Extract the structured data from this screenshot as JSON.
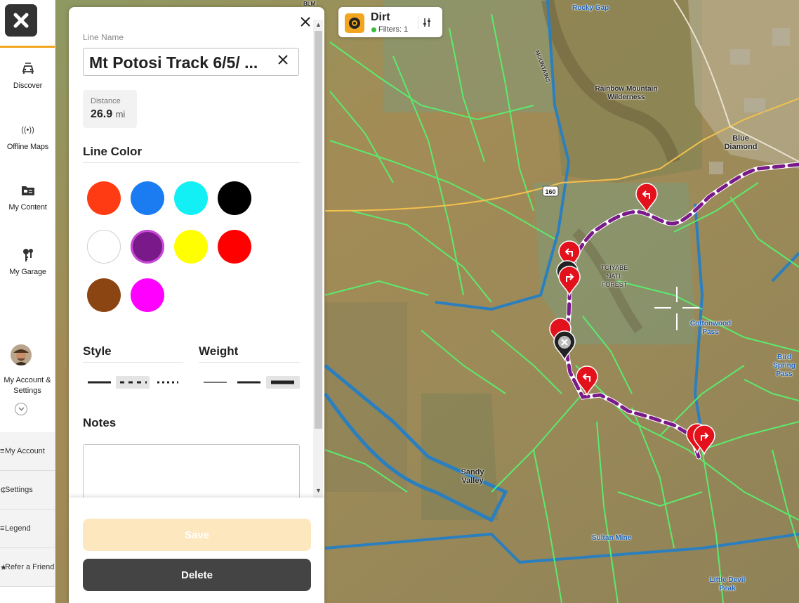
{
  "nav": {
    "items": [
      {
        "label": "Discover",
        "icon": "discover-icon"
      },
      {
        "label": "Offline Maps",
        "icon": "offline-maps-icon",
        "glyph": "((•))"
      },
      {
        "label": "My Content",
        "icon": "my-content-icon"
      },
      {
        "label": "My Garage",
        "icon": "keys-icon"
      }
    ],
    "account": {
      "label": "My Account & Settings"
    },
    "submenu": [
      {
        "label": "My Account",
        "glyph": "≡"
      },
      {
        "label": "Settings",
        "glyph": "⚙"
      },
      {
        "label": "Legend",
        "glyph": "≡"
      },
      {
        "label": "Refer a Friend",
        "glyph": "★"
      }
    ]
  },
  "panel": {
    "line_name_label": "Line Name",
    "line_name_value": "Mt Potosi Track 6/5/ ...",
    "distance_label": "Distance",
    "distance_value": "26.9",
    "distance_unit": "mi",
    "line_color_title": "Line Color",
    "colors": [
      "#ff3b13",
      "#1a7cf0",
      "#13f0f5",
      "#000000",
      "#ffffff",
      "#7a1a8a",
      "#ffff00",
      "#ff0000",
      "#8b4513",
      "#ff00ff"
    ],
    "selected_color": "#7a1a8a",
    "style_title": "Style",
    "weight_title": "Weight",
    "style_selected": "dashed",
    "weight_selected": "thick",
    "notes_title": "Notes",
    "save_label": "Save",
    "delete_label": "Delete"
  },
  "filter": {
    "title": "Dirt",
    "count": "Filters: 1"
  },
  "map": {
    "labels": [
      {
        "text": "Rocky Gap",
        "cls": "blue"
      },
      {
        "text": "Rainbow Mountain Wilderness",
        "cls": "dark"
      },
      {
        "text": "Blue Diamond",
        "cls": "dark"
      },
      {
        "text": "160",
        "cls": "dark"
      },
      {
        "text": "TOIYABE NATL FOREST",
        "cls": "dark"
      },
      {
        "text": "Cottonwood Pass",
        "cls": "blue"
      },
      {
        "text": "Bird Spring Pass",
        "cls": "blue"
      },
      {
        "text": "Sandy Valley",
        "cls": "dark"
      },
      {
        "text": "Sultan Mine",
        "cls": "blue"
      },
      {
        "text": "Little Devil Peak",
        "cls": "blue"
      },
      {
        "text": "BLM",
        "cls": "dark"
      },
      {
        "text": "MOUNTAINS",
        "cls": "dark"
      }
    ]
  }
}
